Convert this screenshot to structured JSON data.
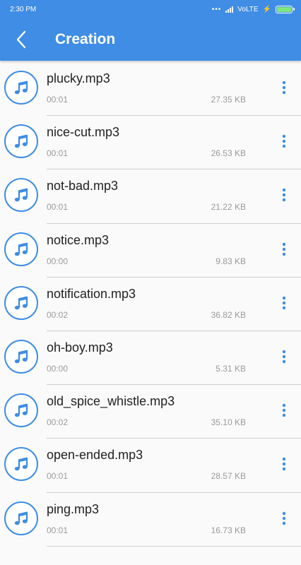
{
  "status_bar": {
    "time": "2:30 PM",
    "network": "VoLTE",
    "icons": [
      "dots-icon",
      "signal-icon",
      "charging-icon",
      "battery-icon"
    ]
  },
  "app_bar": {
    "title": "Creation",
    "back_icon": "chevron-left-icon"
  },
  "colors": {
    "primary": "#3f8de4",
    "battery": "#7ee87a",
    "text_primary": "#222222",
    "text_secondary": "#9a9a9a"
  },
  "files": [
    {
      "name": "plucky.mp3",
      "duration": "00:01",
      "size": "27.35 KB"
    },
    {
      "name": "nice-cut.mp3",
      "duration": "00:01",
      "size": "26.53 KB"
    },
    {
      "name": "not-bad.mp3",
      "duration": "00:01",
      "size": "21.22 KB"
    },
    {
      "name": "notice.mp3",
      "duration": "00:00",
      "size": "9.83 KB"
    },
    {
      "name": "notification.mp3",
      "duration": "00:02",
      "size": "36.82 KB"
    },
    {
      "name": "oh-boy.mp3",
      "duration": "00:00",
      "size": "5.31 KB"
    },
    {
      "name": "old_spice_whistle.mp3",
      "duration": "00:02",
      "size": "35.10 KB"
    },
    {
      "name": "open-ended.mp3",
      "duration": "00:01",
      "size": "28.57 KB"
    },
    {
      "name": "ping.mp3",
      "duration": "00:01",
      "size": "16.73 KB"
    }
  ]
}
